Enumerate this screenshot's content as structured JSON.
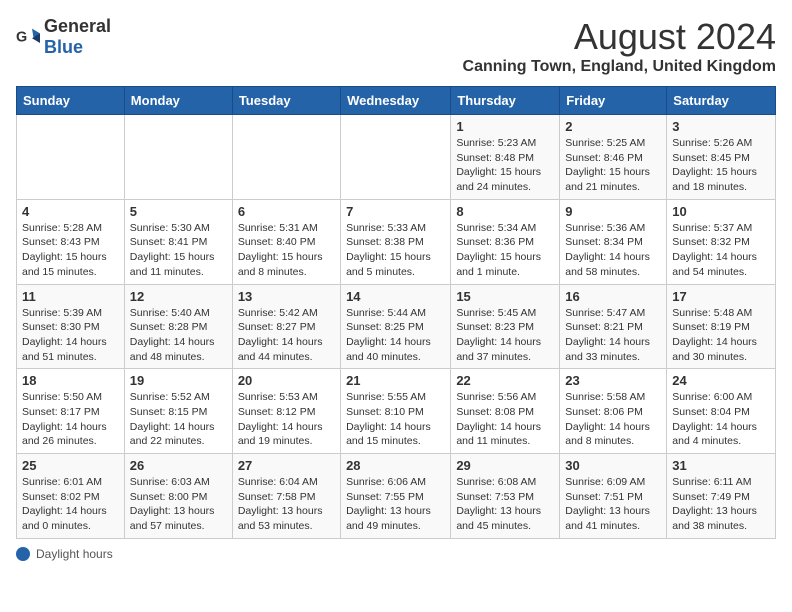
{
  "header": {
    "logo_general": "General",
    "logo_blue": "Blue",
    "title": "August 2024",
    "subtitle": "Canning Town, England, United Kingdom"
  },
  "days_of_week": [
    "Sunday",
    "Monday",
    "Tuesday",
    "Wednesday",
    "Thursday",
    "Friday",
    "Saturday"
  ],
  "weeks": [
    [
      {
        "day": "",
        "info": ""
      },
      {
        "day": "",
        "info": ""
      },
      {
        "day": "",
        "info": ""
      },
      {
        "day": "",
        "info": ""
      },
      {
        "day": "1",
        "info": "Sunrise: 5:23 AM\nSunset: 8:48 PM\nDaylight: 15 hours and 24 minutes."
      },
      {
        "day": "2",
        "info": "Sunrise: 5:25 AM\nSunset: 8:46 PM\nDaylight: 15 hours and 21 minutes."
      },
      {
        "day": "3",
        "info": "Sunrise: 5:26 AM\nSunset: 8:45 PM\nDaylight: 15 hours and 18 minutes."
      }
    ],
    [
      {
        "day": "4",
        "info": "Sunrise: 5:28 AM\nSunset: 8:43 PM\nDaylight: 15 hours and 15 minutes."
      },
      {
        "day": "5",
        "info": "Sunrise: 5:30 AM\nSunset: 8:41 PM\nDaylight: 15 hours and 11 minutes."
      },
      {
        "day": "6",
        "info": "Sunrise: 5:31 AM\nSunset: 8:40 PM\nDaylight: 15 hours and 8 minutes."
      },
      {
        "day": "7",
        "info": "Sunrise: 5:33 AM\nSunset: 8:38 PM\nDaylight: 15 hours and 5 minutes."
      },
      {
        "day": "8",
        "info": "Sunrise: 5:34 AM\nSunset: 8:36 PM\nDaylight: 15 hours and 1 minute."
      },
      {
        "day": "9",
        "info": "Sunrise: 5:36 AM\nSunset: 8:34 PM\nDaylight: 14 hours and 58 minutes."
      },
      {
        "day": "10",
        "info": "Sunrise: 5:37 AM\nSunset: 8:32 PM\nDaylight: 14 hours and 54 minutes."
      }
    ],
    [
      {
        "day": "11",
        "info": "Sunrise: 5:39 AM\nSunset: 8:30 PM\nDaylight: 14 hours and 51 minutes."
      },
      {
        "day": "12",
        "info": "Sunrise: 5:40 AM\nSunset: 8:28 PM\nDaylight: 14 hours and 48 minutes."
      },
      {
        "day": "13",
        "info": "Sunrise: 5:42 AM\nSunset: 8:27 PM\nDaylight: 14 hours and 44 minutes."
      },
      {
        "day": "14",
        "info": "Sunrise: 5:44 AM\nSunset: 8:25 PM\nDaylight: 14 hours and 40 minutes."
      },
      {
        "day": "15",
        "info": "Sunrise: 5:45 AM\nSunset: 8:23 PM\nDaylight: 14 hours and 37 minutes."
      },
      {
        "day": "16",
        "info": "Sunrise: 5:47 AM\nSunset: 8:21 PM\nDaylight: 14 hours and 33 minutes."
      },
      {
        "day": "17",
        "info": "Sunrise: 5:48 AM\nSunset: 8:19 PM\nDaylight: 14 hours and 30 minutes."
      }
    ],
    [
      {
        "day": "18",
        "info": "Sunrise: 5:50 AM\nSunset: 8:17 PM\nDaylight: 14 hours and 26 minutes."
      },
      {
        "day": "19",
        "info": "Sunrise: 5:52 AM\nSunset: 8:15 PM\nDaylight: 14 hours and 22 minutes."
      },
      {
        "day": "20",
        "info": "Sunrise: 5:53 AM\nSunset: 8:12 PM\nDaylight: 14 hours and 19 minutes."
      },
      {
        "day": "21",
        "info": "Sunrise: 5:55 AM\nSunset: 8:10 PM\nDaylight: 14 hours and 15 minutes."
      },
      {
        "day": "22",
        "info": "Sunrise: 5:56 AM\nSunset: 8:08 PM\nDaylight: 14 hours and 11 minutes."
      },
      {
        "day": "23",
        "info": "Sunrise: 5:58 AM\nSunset: 8:06 PM\nDaylight: 14 hours and 8 minutes."
      },
      {
        "day": "24",
        "info": "Sunrise: 6:00 AM\nSunset: 8:04 PM\nDaylight: 14 hours and 4 minutes."
      }
    ],
    [
      {
        "day": "25",
        "info": "Sunrise: 6:01 AM\nSunset: 8:02 PM\nDaylight: 14 hours and 0 minutes."
      },
      {
        "day": "26",
        "info": "Sunrise: 6:03 AM\nSunset: 8:00 PM\nDaylight: 13 hours and 57 minutes."
      },
      {
        "day": "27",
        "info": "Sunrise: 6:04 AM\nSunset: 7:58 PM\nDaylight: 13 hours and 53 minutes."
      },
      {
        "day": "28",
        "info": "Sunrise: 6:06 AM\nSunset: 7:55 PM\nDaylight: 13 hours and 49 minutes."
      },
      {
        "day": "29",
        "info": "Sunrise: 6:08 AM\nSunset: 7:53 PM\nDaylight: 13 hours and 45 minutes."
      },
      {
        "day": "30",
        "info": "Sunrise: 6:09 AM\nSunset: 7:51 PM\nDaylight: 13 hours and 41 minutes."
      },
      {
        "day": "31",
        "info": "Sunrise: 6:11 AM\nSunset: 7:49 PM\nDaylight: 13 hours and 38 minutes."
      }
    ]
  ],
  "footer": {
    "daylight_label": "Daylight hours"
  }
}
